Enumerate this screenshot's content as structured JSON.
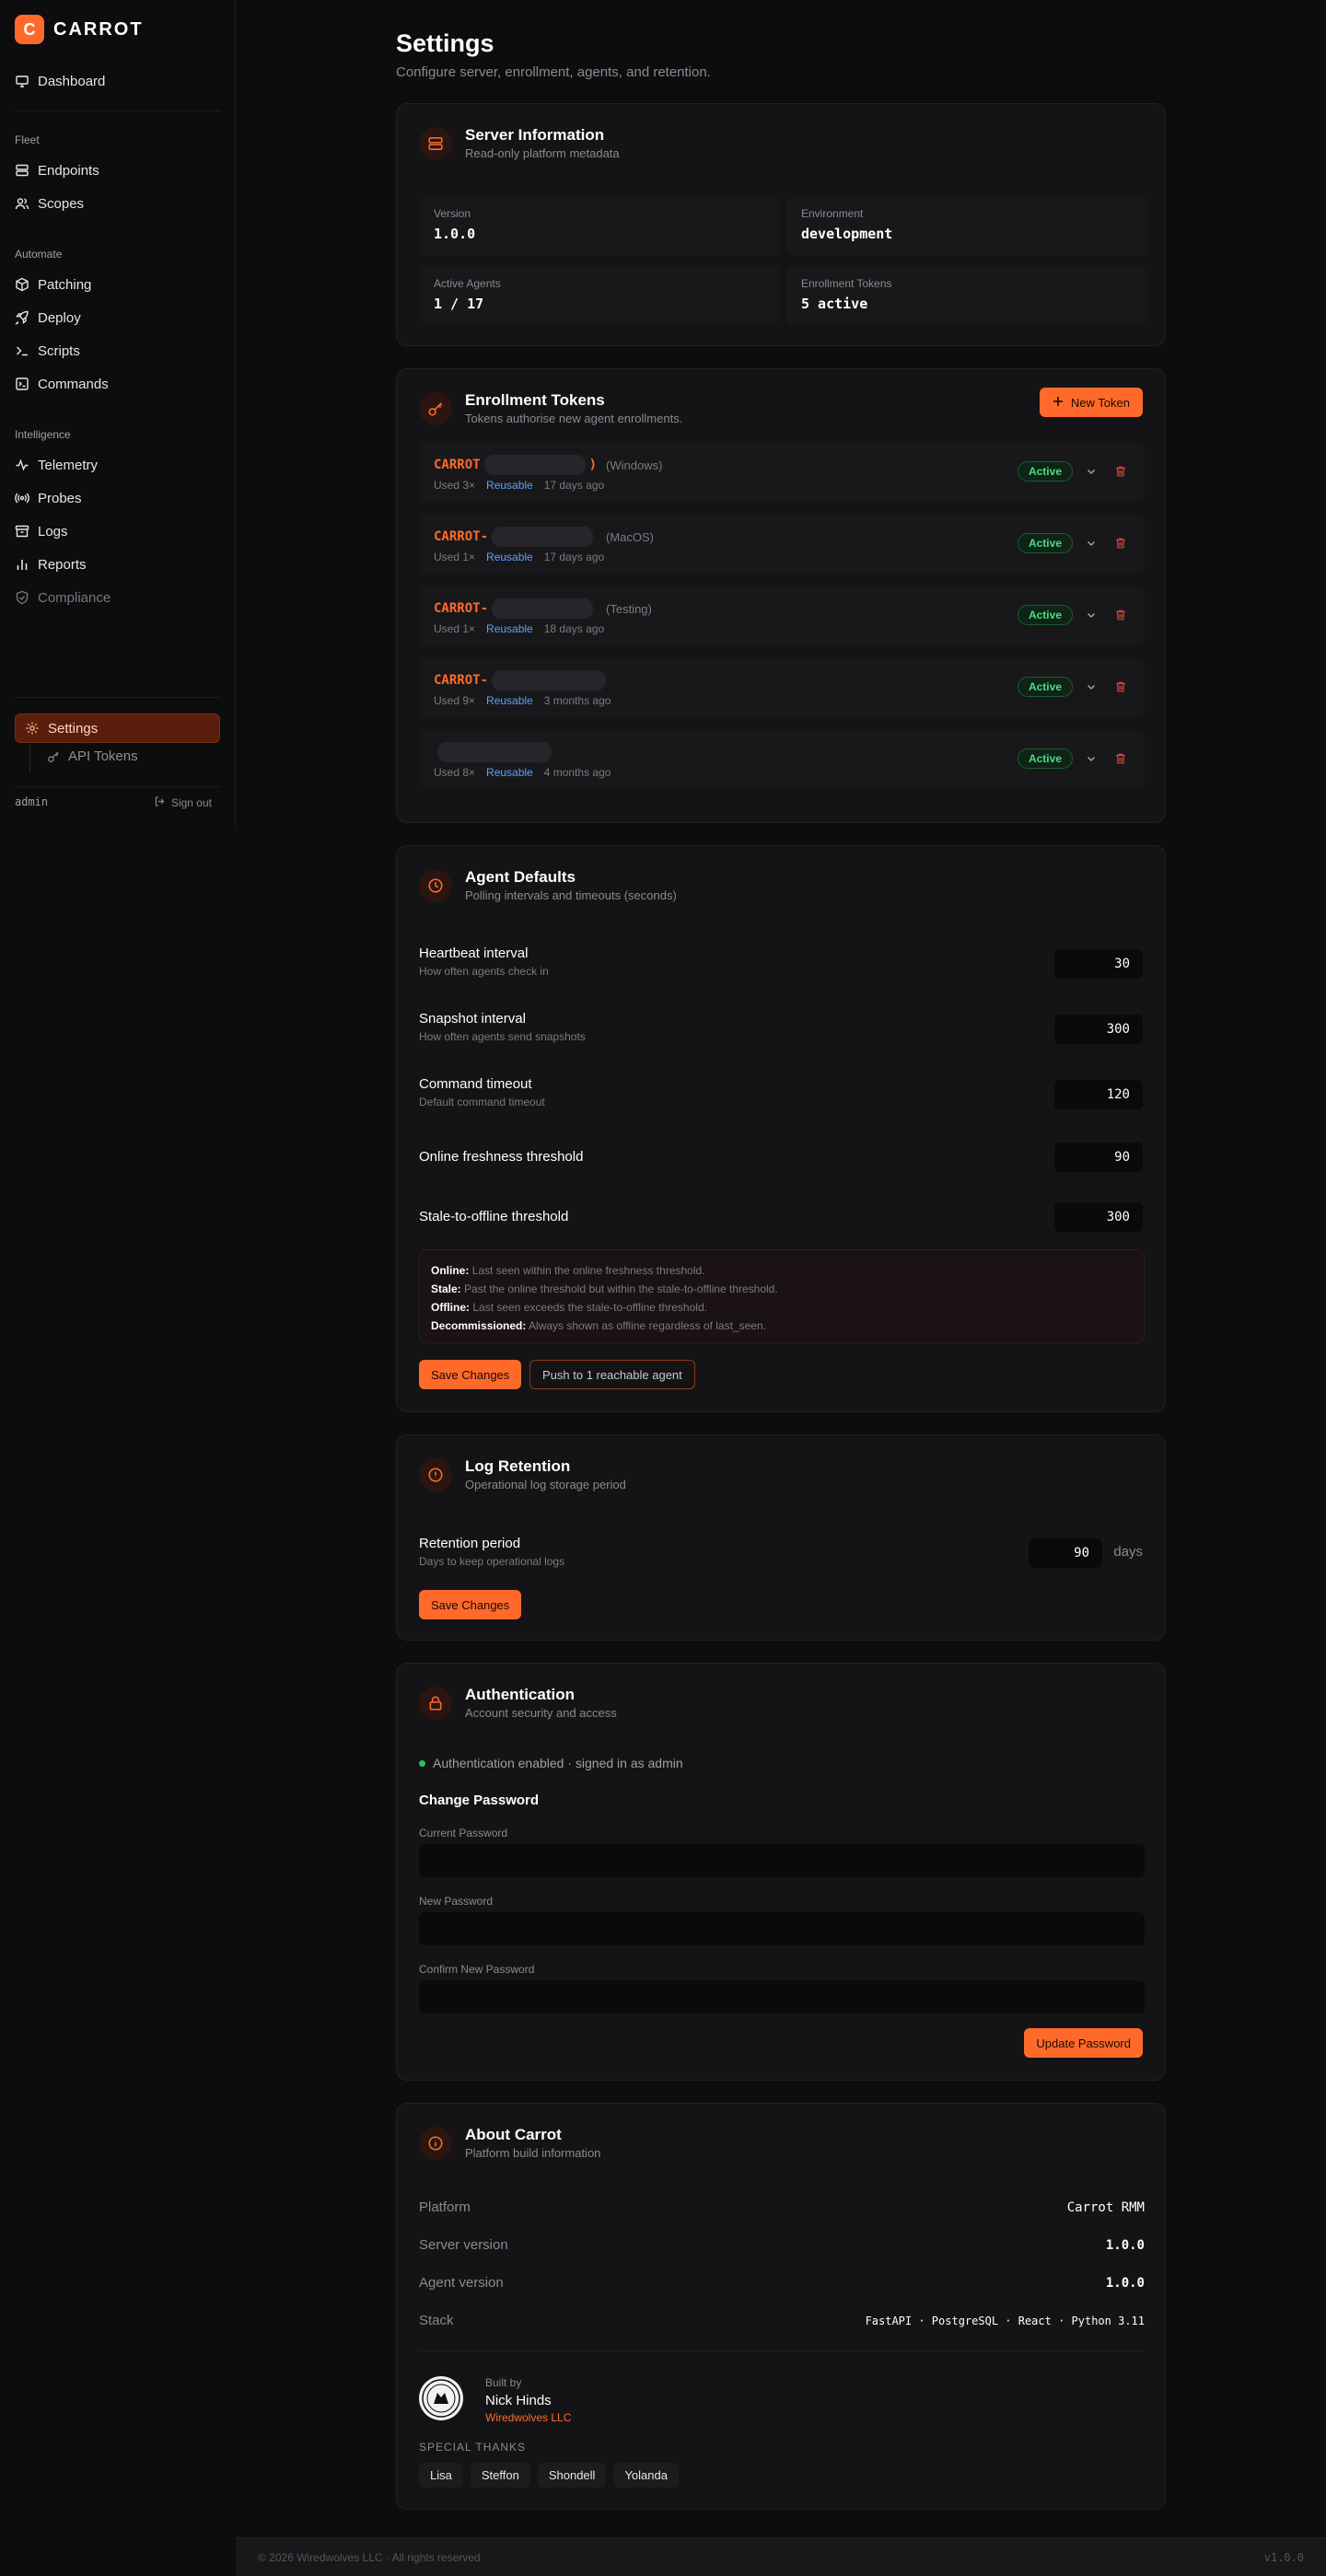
{
  "brand": {
    "mark": "C",
    "name": "CARROT",
    "accent": "#ff6a2b"
  },
  "sidebar": {
    "dashboard": "Dashboard",
    "sections": {
      "fleet": "Fleet",
      "automate": "Automate",
      "intelligence": "Intelligence"
    },
    "fleet_items": [
      "Endpoints",
      "Scopes"
    ],
    "automate_items": [
      "Patching",
      "Deploy",
      "Scripts",
      "Commands"
    ],
    "intelligence_items": [
      "Telemetry",
      "Probes",
      "Logs",
      "Reports",
      "Compliance"
    ],
    "settings": "Settings",
    "api_tokens": "API Tokens",
    "user": "admin",
    "signout": "Sign out"
  },
  "page": {
    "title": "Settings",
    "subtitle": "Configure server, enrollment, agents, and retention."
  },
  "server": {
    "title": "Server Information",
    "subtitle": "Read-only platform metadata",
    "version_label": "Version",
    "version": "1.0.0",
    "env_label": "Environment",
    "env": "development",
    "agents_label": "Active Agents",
    "agents": "1 / 17",
    "tokens_label": "Enrollment Tokens",
    "tokens": "5 active"
  },
  "enrollment": {
    "title": "Enrollment Tokens",
    "subtitle": "Tokens authorise new agent enrollments.",
    "new_button": "New Token",
    "tokens": [
      {
        "prefix": "CARROT",
        "suffix": ")",
        "platform": "(Windows)",
        "used": "Used 3×",
        "reuse": "Reusable",
        "age": "17 days ago",
        "status": "Active"
      },
      {
        "prefix": "CARROT-",
        "suffix": "",
        "platform": "(MacOS)",
        "used": "Used 1×",
        "reuse": "Reusable",
        "age": "17 days ago",
        "status": "Active"
      },
      {
        "prefix": "CARROT-",
        "suffix": "",
        "platform": "(Testing)",
        "used": "Used 1×",
        "reuse": "Reusable",
        "age": "18 days ago",
        "status": "Active"
      },
      {
        "prefix": "CARROT-",
        "suffix": "",
        "platform": "",
        "used": "Used 9×",
        "reuse": "Reusable",
        "age": "3 months ago",
        "status": "Active"
      },
      {
        "prefix": "",
        "suffix": "",
        "platform": "",
        "used": "Used 8×",
        "reuse": "Reusable",
        "age": "4 months ago",
        "status": "Active"
      }
    ]
  },
  "agent_defaults": {
    "title": "Agent Defaults",
    "subtitle": "Polling intervals and timeouts (seconds)",
    "heartbeat_label": "Heartbeat interval",
    "heartbeat_sub": "How often agents check in",
    "heartbeat": "30",
    "snapshot_label": "Snapshot interval",
    "snapshot_sub": "How often agents send snapshots",
    "snapshot": "300",
    "cmd_label": "Command timeout",
    "cmd_sub": "Default command timeout",
    "cmd": "120",
    "fresh_label": "Online freshness threshold",
    "fresh": "90",
    "stale_label": "Stale-to-offline threshold",
    "stale": "300",
    "legend": [
      {
        "k": "Online:",
        "v": "Last seen within the online freshness threshold."
      },
      {
        "k": "Stale:",
        "v": "Past the online threshold but within the stale-to-offline threshold."
      },
      {
        "k": "Offline:",
        "v": "Last seen exceeds the stale-to-offline threshold."
      },
      {
        "k": "Decommissioned:",
        "v": "Always shown as offline regardless of last_seen."
      }
    ],
    "save": "Save Changes",
    "push": "Push to 1 reachable agent"
  },
  "retention": {
    "title": "Log Retention",
    "subtitle": "Operational log storage period",
    "label": "Retention period",
    "sub": "Days to keep operational logs",
    "value": "90",
    "unit": "days",
    "save": "Save Changes"
  },
  "auth": {
    "title": "Authentication",
    "subtitle": "Account security and access",
    "status": "Authentication enabled · signed in as admin",
    "change": "Change Password",
    "current": "Current Password",
    "new": "New Password",
    "confirm": "Confirm New Password",
    "update": "Update Password"
  },
  "about": {
    "title": "About Carrot",
    "subtitle": "Platform build information",
    "rows": [
      {
        "k": "Platform",
        "v": "Carrot RMM"
      },
      {
        "k": "Server version",
        "v": "1.0.0"
      },
      {
        "k": "Agent version",
        "v": "1.0.0"
      },
      {
        "k": "Stack",
        "v": "FastAPI · PostgreSQL · React · Python 3.11"
      }
    ],
    "built_by": "Built by",
    "author": "Nick Hinds",
    "company": "Wiredwolves LLC",
    "thanks_label": "SPECIAL THANKS",
    "thanks": [
      "Lisa",
      "Steffon",
      "Shondell",
      "Yolanda"
    ]
  },
  "footer": {
    "copyright": "© 2026 Wiredwolves LLC · All rights reserved",
    "version": "v1.0.0"
  }
}
